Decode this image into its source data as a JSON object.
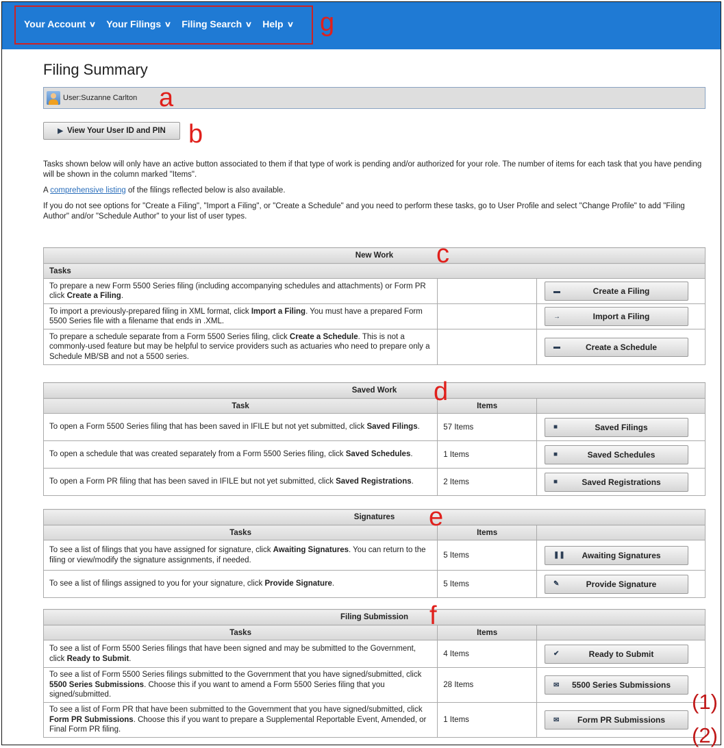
{
  "nav": {
    "items": [
      {
        "label": "Your Account"
      },
      {
        "label": "Your Filings"
      },
      {
        "label": "Filing Search"
      },
      {
        "label": "Help"
      }
    ]
  },
  "annotations": {
    "a": "a",
    "b": "b",
    "c": "c",
    "d": "d",
    "e": "e",
    "f": "f",
    "g": "g",
    "n1": "(1)",
    "n2": "(2)"
  },
  "page": {
    "title": "Filing Summary"
  },
  "user": {
    "label": "User:Suzanne Carlton"
  },
  "userid_button": "View Your User ID and PIN",
  "intro": {
    "p1": "Tasks shown below will only have an active button associated to them if that type of work is pending and/or authorized for your role. The number of items for each task that you have pending will be shown in the column marked \"Items\".",
    "p2_prefix": "A ",
    "p2_link": "comprehensive listing",
    "p2_suffix": " of the filings reflected below is also available.",
    "p3": "If you do not see options for \"Create a Filing\", \"Import a Filing\", or \"Create a Schedule\" and you need to perform these tasks, go to User Profile and select \"Change Profile\" to add \"Filing Author\" and/or \"Schedule Author\" to your list of user types."
  },
  "new_work": {
    "title": "New Work",
    "col_tasks": "Tasks",
    "rows": [
      {
        "pre": "To prepare a new Form 5500 Series filing (including accompanying schedules and attachments) or Form PR  click ",
        "bold": "Create a Filing",
        "post": ".",
        "button": "Create a Filing",
        "icon": "folder-icon"
      },
      {
        "pre": "To import a previously-prepared filing in XML format, click ",
        "bold": "Import a Filing",
        "post": ". You must have a prepared Form 5500 Series file with a filename that ends in .XML.",
        "button": "Import a Filing",
        "icon": "arrow-right-icon"
      },
      {
        "pre": "To prepare a schedule separate from a Form 5500 Series filing, click ",
        "bold": "Create a Schedule",
        "post": ". This is not a commonly-used feature but may be helpful to service providers such as actuaries who need to prepare only a Schedule MB/SB and not a 5500 series.",
        "button": "Create a Schedule",
        "icon": "folder-icon"
      }
    ]
  },
  "saved_work": {
    "title": "Saved Work",
    "col_task": "Task",
    "col_items": "Items",
    "rows": [
      {
        "pre": "To open a Form 5500 Series filing that has been saved in IFILE but not yet submitted, click ",
        "bold": "Saved Filings",
        "post": ".",
        "items": "57 Items",
        "button": "Saved Filings",
        "icon": "save-icon"
      },
      {
        "pre": "To open a schedule that was created separately from a Form 5500 Series filing, click ",
        "bold": "Saved Schedules",
        "post": ".",
        "items": "1 Items",
        "button": "Saved Schedules",
        "icon": "save-icon"
      },
      {
        "pre": "To open a Form PR filing that has been saved in IFILE but not yet submitted, click ",
        "bold": "Saved Registrations",
        "post": ".",
        "items": "2 Items",
        "button": "Saved Registrations",
        "icon": "save-icon"
      }
    ]
  },
  "signatures": {
    "title": "Signatures",
    "col_tasks": "Tasks",
    "col_items": "Items",
    "rows": [
      {
        "pre": "To see a list of filings that you have assigned for signature, click ",
        "bold": "Awaiting Signatures",
        "post": ". You can return to the filing or view/modify the signature assignments, if needed.",
        "items": "5 Items",
        "button": "Awaiting Signatures",
        "icon": "pause-icon"
      },
      {
        "pre": "To see a list of filings assigned to you for your signature, click ",
        "bold": "Provide Signature",
        "post": ".",
        "items": "5 Items",
        "button": "Provide Signature",
        "icon": "pencil-icon"
      }
    ]
  },
  "submission": {
    "title": "Filing Submission",
    "col_tasks": "Tasks",
    "col_items": "Items",
    "rows": [
      {
        "pre": "To see a list of Form 5500 Series filings that have been signed and may be submitted to the Government, click ",
        "bold": "Ready to Submit",
        "post": ".",
        "items": "4 Items",
        "button": "Ready to Submit",
        "icon": "check-circle-icon"
      },
      {
        "pre": "To see a list of Form 5500 Series filings submitted to the Government that you have signed/submitted, click ",
        "bold": "5500 Series Submissions",
        "post": ". Choose this if you want to amend a Form 5500 Series filing that you signed/submitted.",
        "items": "28 Items",
        "button": "5500 Series Submissions",
        "icon": "envelope-icon"
      },
      {
        "pre": "To see a list of Form PR that have been submitted to the Government that you have signed/submitted, click ",
        "bold": "Form PR Submissions",
        "post": ". Choose this if you want to prepare a Supplemental Reportable Event, Amended, or Final Form PR filing.",
        "items": "1 Items",
        "button": "Form PR Submissions",
        "icon": "envelope-icon"
      }
    ]
  }
}
